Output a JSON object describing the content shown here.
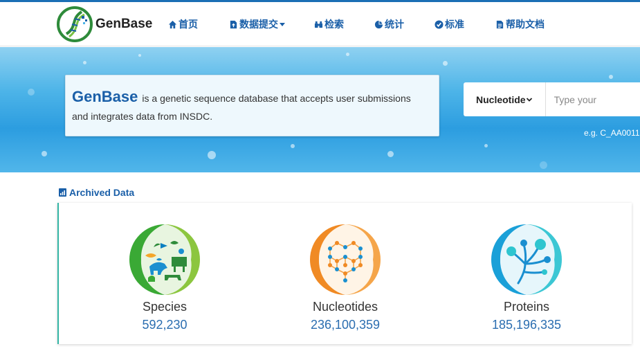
{
  "brand": {
    "name": "GenBase"
  },
  "nav": [
    {
      "label": "首页",
      "icon": "home-icon"
    },
    {
      "label": "数据提交",
      "icon": "upload-file-icon",
      "dropdown": true
    },
    {
      "label": "检索",
      "icon": "binoculars-icon"
    },
    {
      "label": "统计",
      "icon": "pie-chart-icon"
    },
    {
      "label": "标准",
      "icon": "check-circle-icon"
    },
    {
      "label": "帮助文档",
      "icon": "document-icon"
    }
  ],
  "hero": {
    "brand": "GenBase",
    "description_1": "is a genetic sequence database that accepts user submissions",
    "description_2": "and integrates data from INSDC."
  },
  "search": {
    "selected_type": "Nucleotide",
    "placeholder": "Type your",
    "example": "e.g. C_AA0011"
  },
  "archived": {
    "title": "Archived Data",
    "stats": [
      {
        "label": "Species",
        "value": "592,230",
        "icon": "species-icon"
      },
      {
        "label": "Nucleotides",
        "value": "236,100,359",
        "icon": "nucleotides-icon"
      },
      {
        "label": "Proteins",
        "value": "185,196,335",
        "icon": "proteins-icon"
      }
    ]
  },
  "colors": {
    "accent": "#1a5fa8",
    "panel_border": "#33b5a5",
    "stat_value": "#2a6db0"
  }
}
